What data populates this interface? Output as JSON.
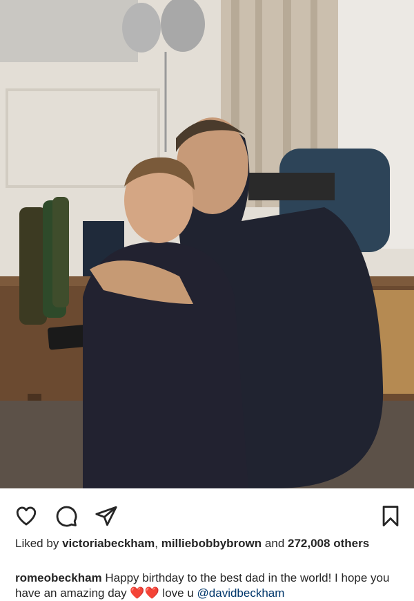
{
  "post": {
    "photo_alt": "Photo of a father and son hugging",
    "actions": {
      "like_icon": "heart-outline-icon",
      "comment_icon": "speech-bubble-icon",
      "share_icon": "paper-plane-icon",
      "save_icon": "bookmark-icon"
    },
    "likes": {
      "prefix": "Liked by",
      "user1": "victoriabeckham",
      "separator": ",",
      "user2": "milliebobbybrown",
      "and_text": "and",
      "count": "272,008",
      "suffix": "others"
    },
    "caption": {
      "username": "romeobeckham",
      "text": "Happy birthday to the best dad in the world! I hope you have an amazing day",
      "emoji": "❤️❤️",
      "after_emoji": "love u",
      "mention": "@davidbeckham"
    }
  },
  "colors": {
    "text": "#262626",
    "link": "#00376b",
    "heart": "#e0245e"
  }
}
